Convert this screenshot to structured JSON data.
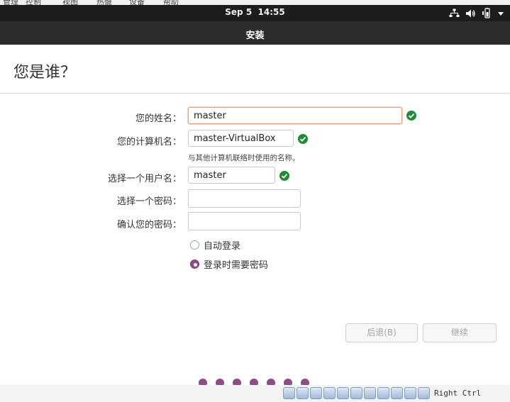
{
  "host_menu": [
    "管理",
    "控制",
    "视图",
    "热键",
    "设备",
    "帮助"
  ],
  "topbar": {
    "date": "Sep 5",
    "time": "14:55"
  },
  "window": {
    "title": "安装"
  },
  "page": {
    "title": "您是谁？"
  },
  "form": {
    "name": {
      "label": "您的姓名：",
      "value": "master"
    },
    "computer": {
      "label": "您的计算机名：",
      "value": "master-VirtualBox",
      "hint": "与其他计算机联络时使用的名称。"
    },
    "username": {
      "label": "选择一个用户名：",
      "value": "master"
    },
    "password": {
      "label": "选择一个密码：",
      "value": ""
    },
    "confirm": {
      "label": "确认您的密码：",
      "value": ""
    },
    "login_options": [
      {
        "label": "自动登录",
        "selected": false
      },
      {
        "label": "登录时需要密码",
        "selected": true
      }
    ]
  },
  "buttons": {
    "back": "后退(B)",
    "continue": "继续"
  },
  "progress": {
    "total_steps": 7
  },
  "statusbar": {
    "host_key": "Right Ctrl"
  },
  "colors": {
    "accent": "#8c4f86",
    "ok": "#1f8a38",
    "focus_border": "#e9a07a"
  }
}
